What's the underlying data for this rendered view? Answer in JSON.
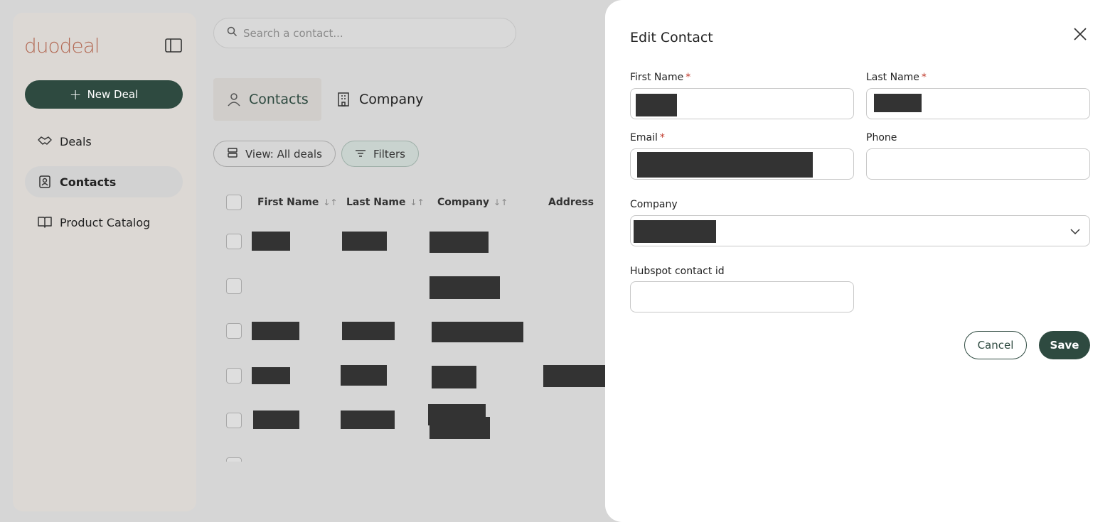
{
  "sidebar": {
    "logo": "duodeal",
    "new_deal_label": "New Deal",
    "items": [
      {
        "label": "Deals",
        "icon": "handshake-icon"
      },
      {
        "label": "Contacts",
        "icon": "contact-book-icon",
        "active": true
      },
      {
        "label": "Product Catalog",
        "icon": "book-open-icon"
      }
    ]
  },
  "search": {
    "placeholder": "Search a contact..."
  },
  "tabs": [
    {
      "label": "Contacts",
      "icon": "user-icon",
      "active": true
    },
    {
      "label": "Company",
      "icon": "building-icon"
    }
  ],
  "toolbar": {
    "view_label": "View: All deals",
    "filters_label": "Filters"
  },
  "table": {
    "headers": [
      "First Name",
      "Last Name",
      "Company",
      "Address"
    ],
    "sort_glyph": "↓↑"
  },
  "edit_panel": {
    "title": "Edit Contact",
    "fields": {
      "first_name": {
        "label": "First Name",
        "required": "*"
      },
      "last_name": {
        "label": "Last Name",
        "required": "*"
      },
      "email": {
        "label": "Email",
        "required": "*"
      },
      "phone": {
        "label": "Phone",
        "value": ""
      },
      "company": {
        "label": "Company"
      },
      "hubspot_id": {
        "label": "Hubspot contact id",
        "value": ""
      }
    },
    "cancel_label": "Cancel",
    "save_label": "Save"
  },
  "colors": {
    "primary": "#2e4a40",
    "logo": "#b36a55",
    "required": "#c0392b"
  }
}
